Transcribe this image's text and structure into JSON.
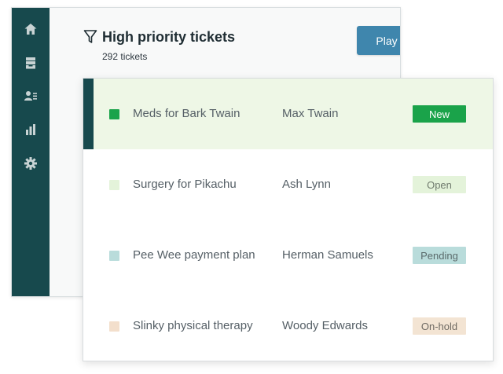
{
  "sidebar": {
    "items": [
      {
        "icon": "home-icon"
      },
      {
        "icon": "inbox-stack-icon"
      },
      {
        "icon": "users-icon"
      },
      {
        "icon": "bar-chart-icon"
      },
      {
        "icon": "gear-icon"
      }
    ],
    "background": "#17494d",
    "icon_color": "#c8d3d4"
  },
  "view": {
    "title": "High priority tickets",
    "count": "292 tickets",
    "filter_icon": "funnel-icon",
    "play_label": "Play"
  },
  "tickets": [
    {
      "subject": "Meds for Bark Twain",
      "requester": "Max Twain",
      "status": "New",
      "square_color": "#1aa34a",
      "badge_bg": "#1aa34a",
      "badge_fg": "#ffffff",
      "selected": true
    },
    {
      "subject": "Surgery for Pikachu",
      "requester": "Ash Lynn",
      "status": "Open",
      "square_color": "#e4f3da",
      "badge_bg": "#e4f3da",
      "badge_fg": "#6f7a6d",
      "selected": false
    },
    {
      "subject": "Pee Wee payment plan",
      "requester": "Herman Samuels",
      "status": "Pending",
      "square_color": "#b9dcdb",
      "badge_bg": "#b9dcdb",
      "badge_fg": "#5a6a6b",
      "selected": false
    },
    {
      "subject": "Slinky physical therapy",
      "requester": "Woody Edwards",
      "status": "On-hold",
      "square_color": "#f3dfcc",
      "badge_bg": "#f3e4d3",
      "badge_fg": "#6f6a63",
      "selected": false
    }
  ],
  "colors": {
    "accent": "#3f86ad",
    "selected_row_bg": "#eef7e6"
  }
}
